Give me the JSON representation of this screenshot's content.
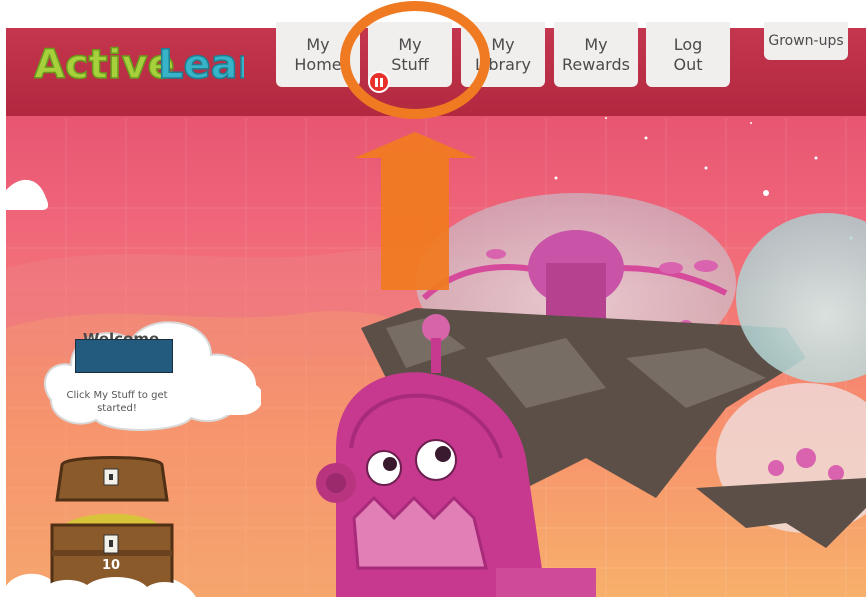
{
  "app": {
    "logo_text": "ActiveLearn"
  },
  "nav": {
    "items": [
      {
        "line1": "My",
        "line2": "Home"
      },
      {
        "line1": "My",
        "line2": "Stuff"
      },
      {
        "line1": "My",
        "line2": "Library"
      },
      {
        "line1": "My",
        "line2": "Rewards"
      },
      {
        "line1": "Log",
        "line2": "Out"
      }
    ],
    "grownups_label": "Grown-ups"
  },
  "welcome": {
    "title": "Welcome",
    "hint": "Click My Stuff to get started!"
  },
  "rewards": {
    "chest_count": "10"
  },
  "colors": {
    "header": "#b92d44",
    "annotation_orange": "#f07a22",
    "pause_badge": "#e8312b",
    "robot_pink": "#c6398f"
  },
  "annotation": {
    "highlighted_target": "My Stuff"
  }
}
